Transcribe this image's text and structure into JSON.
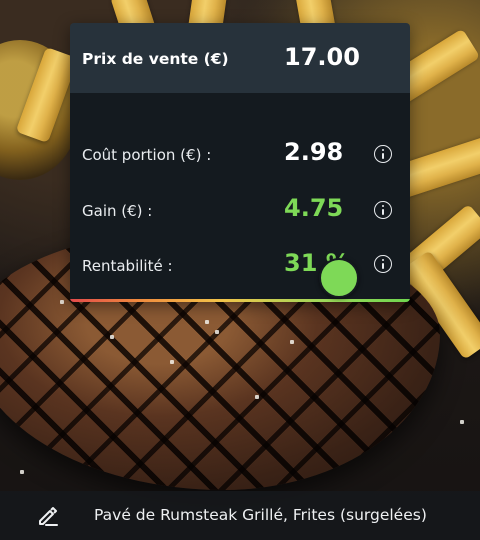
{
  "card": {
    "sale_price_label": "Prix de vente (€)",
    "sale_price_value": "17.00",
    "rows": [
      {
        "label": "Coût portion (€) :",
        "value": "2.98",
        "icon": "info-icon"
      },
      {
        "label": "Gain (€) :",
        "value": "4.75",
        "icon": "info-icon"
      },
      {
        "label": "Rentabilité :",
        "value": "31 %",
        "icon": "info-icon"
      }
    ],
    "profitability_slider_fraction": 0.79
  },
  "footer": {
    "icon": "edit-icon",
    "dish_name": "Pavé de Rumsteak Grillé, Frites (surgelées)"
  },
  "colors": {
    "card_header": "#27323b",
    "card_body": "#141a1f",
    "positive": "#7ed957"
  }
}
